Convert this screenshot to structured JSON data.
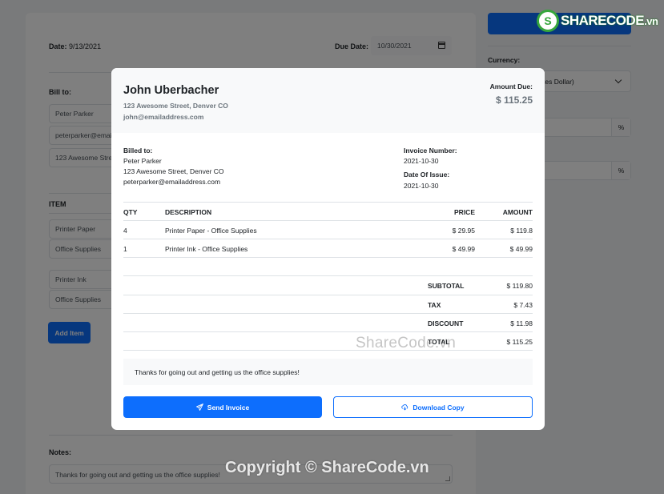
{
  "form": {
    "date_label": "Date:",
    "date_value": "9/13/2021",
    "due_label": "Due Date:",
    "due_value": "10/30/2021",
    "bill_to_label": "Bill to:",
    "bill_to_name": "Peter Parker",
    "bill_to_email": "peterparker@emai",
    "bill_to_address": "123 Awesome Stre",
    "item_label": "ITEM",
    "items": [
      {
        "name": "Printer Paper",
        "desc": "Office Supplies"
      },
      {
        "name": "Printer Ink",
        "desc": "Office Supplies"
      }
    ],
    "add_item": "Add Item",
    "notes_label": "Notes:",
    "notes_value": "Thanks for going out and getting us the office supplies!"
  },
  "sidebar": {
    "currency_label": "Currency:",
    "currency_value": "tes Dollar)",
    "pct_symbol": "%"
  },
  "modal": {
    "from_name": "John Uberbacher",
    "from_address": "123 Awesome Street, Denver CO",
    "from_email": "john@emailaddress.com",
    "amount_due_label": "Amount Due:",
    "amount_due": "$ 115.25",
    "billed_to_label": "Billed to:",
    "billed_to_name": "Peter Parker",
    "billed_to_address": "123 Awesome Street, Denver CO",
    "billed_to_email": "peterparker@emailaddress.com",
    "invoice_number_label": "Invoice Number:",
    "invoice_number": "2021-10-30",
    "date_of_issue_label": "Date Of Issue:",
    "date_of_issue": "2021-10-30",
    "columns": [
      "QTY",
      "DESCRIPTION",
      "PRICE",
      "AMOUNT"
    ],
    "rows": [
      {
        "qty": "4",
        "desc": "Printer Paper - Office Supplies",
        "price": "$ 29.95",
        "amount": "$ 119.8"
      },
      {
        "qty": "1",
        "desc": "Printer Ink - Office Supplies",
        "price": "$ 49.99",
        "amount": "$ 49.99"
      }
    ],
    "subtotal_label": "SUBTOTAL",
    "subtotal": "$ 119.80",
    "tax_label": "TAX",
    "tax": "$ 7.43",
    "discount_label": "DISCOUNT",
    "discount": "$ 11.98",
    "total_label": "TOTAL",
    "total": "$ 115.25",
    "notes": "Thanks for going out and getting us the office supplies!",
    "send_label": "Send Invoice",
    "download_label": "Download Copy"
  },
  "watermarks": {
    "logo_text": "SHARECODE",
    "logo_suffix": ".vn",
    "mid": "ShareCode.vn",
    "bottom": "Copyright © ShareCode.vn"
  },
  "colors": {
    "primary": "#0d6efd",
    "overlay": "rgba(0,0,0,0.5)",
    "logo_green": "#36a63c"
  }
}
